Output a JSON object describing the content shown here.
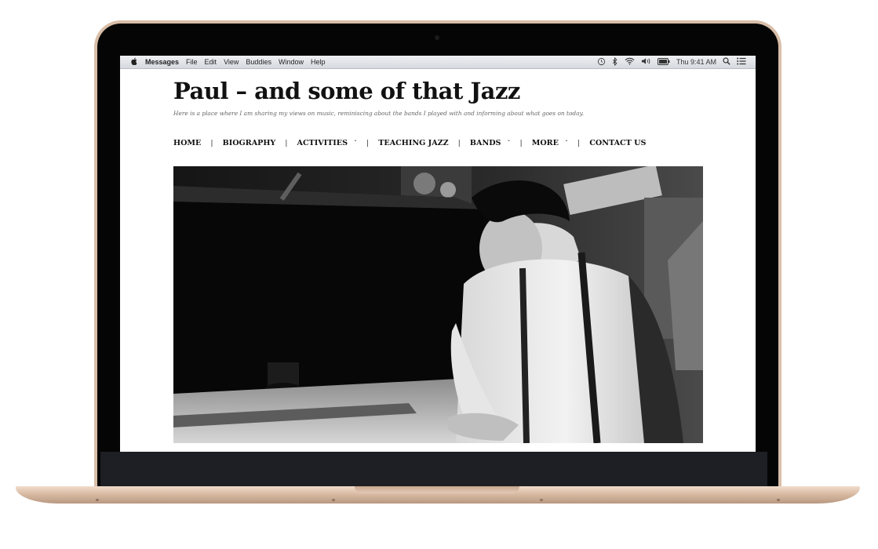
{
  "menubar": {
    "apple_icon": "apple-logo-icon",
    "app_name": "Messages",
    "menus": [
      "File",
      "Edit",
      "View",
      "Buddies",
      "Window",
      "Help"
    ],
    "status_icons": [
      "time-machine-icon",
      "bluetooth-icon",
      "wifi-icon",
      "volume-icon",
      "battery-icon"
    ],
    "clock": "Thu 9:41 AM",
    "search_icon": "spotlight-search-icon",
    "list_icon": "notification-center-icon"
  },
  "site": {
    "title": "Paul – and some of that Jazz",
    "tagline": "Here is a place where I am sharing my views on music, reminiscing about the bands I played with and informing about what goes on today.",
    "nav": [
      {
        "label": "HOME",
        "dropdown": false
      },
      {
        "label": "BIOGRAPHY",
        "dropdown": false
      },
      {
        "label": "ACTIVITIES",
        "dropdown": true
      },
      {
        "label": "TEACHING JAZZ",
        "dropdown": false
      },
      {
        "label": "BANDS",
        "dropdown": true
      },
      {
        "label": "MORE",
        "dropdown": true
      },
      {
        "label": "CONTACT US",
        "dropdown": false
      }
    ],
    "separator": "|",
    "dropdown_glyph": "ˇ"
  },
  "hero": {
    "description_icon": "black-and-white-photo-pianist",
    "colors": {
      "dark": "#0c0c0c",
      "light": "#ececec"
    }
  },
  "frame_colors": {
    "gold": "#d9bea8",
    "bezel": "#050505"
  }
}
